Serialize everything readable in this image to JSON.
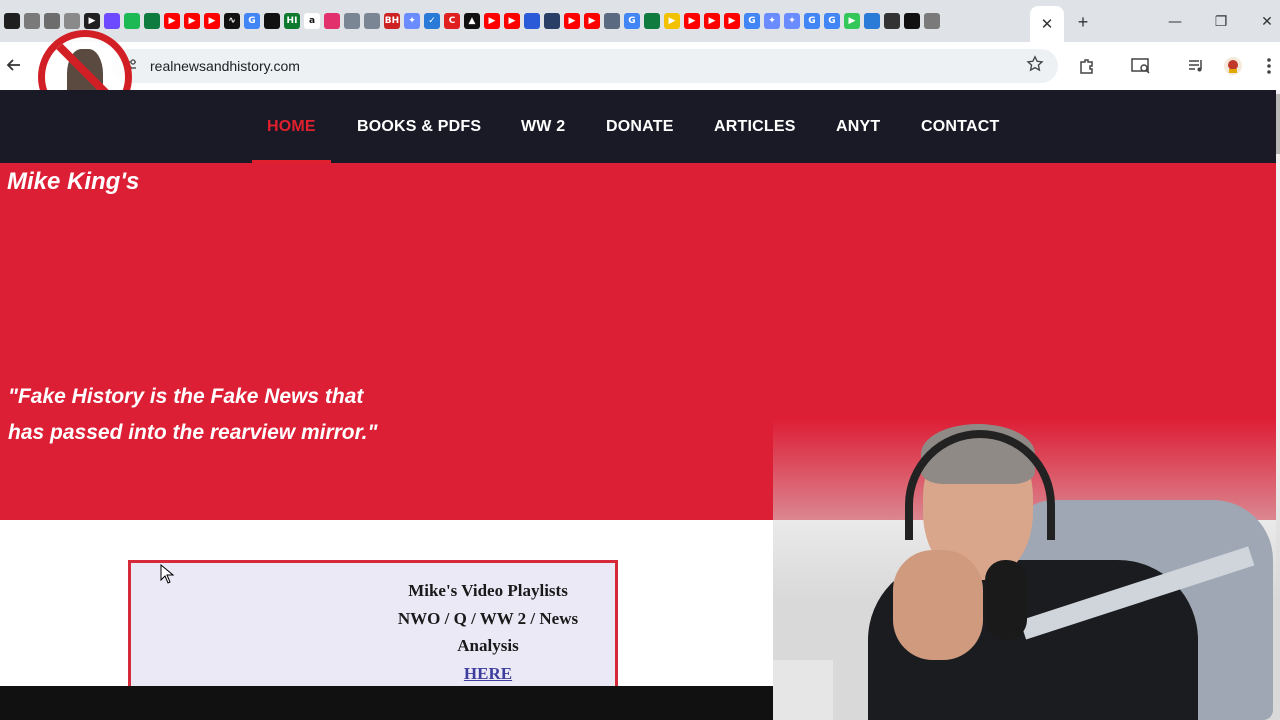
{
  "browser": {
    "active_tab_close": "✕",
    "new_tab": "+",
    "window_controls": {
      "minimize": "—",
      "maximize": "❐",
      "close": "✕"
    },
    "address_bar": {
      "url": "realnewsandhistory.com"
    },
    "icons": [
      "back-arrow-icon",
      "site-info-icon",
      "bookmark-star-icon",
      "extensions-icon",
      "tab-search-icon",
      "media-control-icon",
      "profile-avatar-icon",
      "more-menu-icon"
    ]
  },
  "tab_favicons": [
    {
      "name": "perplexity",
      "color": "#1f1f1f",
      "glyph": ""
    },
    {
      "name": "a",
      "color": "#7a7a7a",
      "glyph": ""
    },
    {
      "name": "g",
      "color": "#6d6d6d",
      "glyph": ""
    },
    {
      "name": "i",
      "color": "#8a8a8a",
      "glyph": ""
    },
    {
      "name": "play",
      "color": "#1f1f1f",
      "glyph": "▶"
    },
    {
      "name": "proton",
      "color": "#6d4aff",
      "glyph": ""
    },
    {
      "name": "spotify",
      "color": "#1db954",
      "glyph": ""
    },
    {
      "name": "chart",
      "color": "#0f7b3e",
      "glyph": ""
    },
    {
      "name": "youtube",
      "color": "#ff0000",
      "glyph": "▶"
    },
    {
      "name": "youtube",
      "color": "#ff0000",
      "glyph": "▶"
    },
    {
      "name": "youtube",
      "color": "#ff0000",
      "glyph": "▶"
    },
    {
      "name": "wave",
      "color": "#111111",
      "glyph": "∿"
    },
    {
      "name": "google",
      "color": "#4285f4",
      "glyph": "G"
    },
    {
      "name": "square",
      "color": "#111111",
      "glyph": ""
    },
    {
      "name": "hi",
      "color": "#0e7a2e",
      "glyph": "HI"
    },
    {
      "name": "amazon",
      "color": "#ffffff",
      "glyph": "a"
    },
    {
      "name": "instagram",
      "color": "#e1306c",
      "glyph": ""
    },
    {
      "name": "grid",
      "color": "#7a8694",
      "glyph": ""
    },
    {
      "name": "grid",
      "color": "#7a8694",
      "glyph": ""
    },
    {
      "name": "bh",
      "color": "#cc2222",
      "glyph": "BH"
    },
    {
      "name": "gemini",
      "color": "#6b8cff",
      "glyph": "✦"
    },
    {
      "name": "check",
      "color": "#2a7ad8",
      "glyph": "✓"
    },
    {
      "name": "c",
      "color": "#e02020",
      "glyph": "C"
    },
    {
      "name": "arrow",
      "color": "#111111",
      "glyph": "▲"
    },
    {
      "name": "youtube",
      "color": "#ff0000",
      "glyph": "▶"
    },
    {
      "name": "youtube",
      "color": "#ff0000",
      "glyph": "▶"
    },
    {
      "name": "globe",
      "color": "#2a5ad8",
      "glyph": ""
    },
    {
      "name": "cat",
      "color": "#2a3f66",
      "glyph": ""
    },
    {
      "name": "youtube",
      "color": "#ff0000",
      "glyph": "▶"
    },
    {
      "name": "youtube",
      "color": "#ff0000",
      "glyph": "▶"
    },
    {
      "name": "vpn",
      "color": "#5a6a80",
      "glyph": ""
    },
    {
      "name": "google",
      "color": "#4285f4",
      "glyph": "G"
    },
    {
      "name": "chart",
      "color": "#0f7b3e",
      "glyph": ""
    },
    {
      "name": "yellow",
      "color": "#f2c200",
      "glyph": "▶"
    },
    {
      "name": "youtube",
      "color": "#ff0000",
      "glyph": "▶"
    },
    {
      "name": "youtube",
      "color": "#ff0000",
      "glyph": "▶"
    },
    {
      "name": "youtube",
      "color": "#ff0000",
      "glyph": "▶"
    },
    {
      "name": "google",
      "color": "#4285f4",
      "glyph": "G"
    },
    {
      "name": "gemini",
      "color": "#6b8cff",
      "glyph": "✦"
    },
    {
      "name": "gemini",
      "color": "#6b8cff",
      "glyph": "✦"
    },
    {
      "name": "google",
      "color": "#4285f4",
      "glyph": "G"
    },
    {
      "name": "google",
      "color": "#4285f4",
      "glyph": "G"
    },
    {
      "name": "green",
      "color": "#34c759",
      "glyph": "▶"
    },
    {
      "name": "blue",
      "color": "#2a7ad8",
      "glyph": ""
    },
    {
      "name": "museum",
      "color": "#333333",
      "glyph": ""
    },
    {
      "name": "x",
      "color": "#111111",
      "glyph": ""
    },
    {
      "name": "globe",
      "color": "#7a7a7a",
      "glyph": ""
    }
  ],
  "site": {
    "nav": {
      "items": [
        "HOME",
        "BOOKS & PDFS",
        "WW 2",
        "DONATE",
        "ARTICLES",
        "ANYT",
        "CONTACT"
      ],
      "active_index": 0
    },
    "hero": {
      "title": "Mike King's",
      "quote_line1": "\"Fake History is the Fake News that",
      "quote_line2": "has passed into the rearview mirror.\""
    },
    "playlist": {
      "line1": "Mike's Video Playlists",
      "line2": "NWO / Q / WW 2 / News",
      "line3": "Analysis",
      "link": "HERE"
    }
  },
  "colors": {
    "nav_bg": "#191a26",
    "accent_red": "#dd1f36",
    "nav_active": "#e0202e",
    "playlist_bg": "#ece9f7",
    "link": "#3d3d9e"
  }
}
